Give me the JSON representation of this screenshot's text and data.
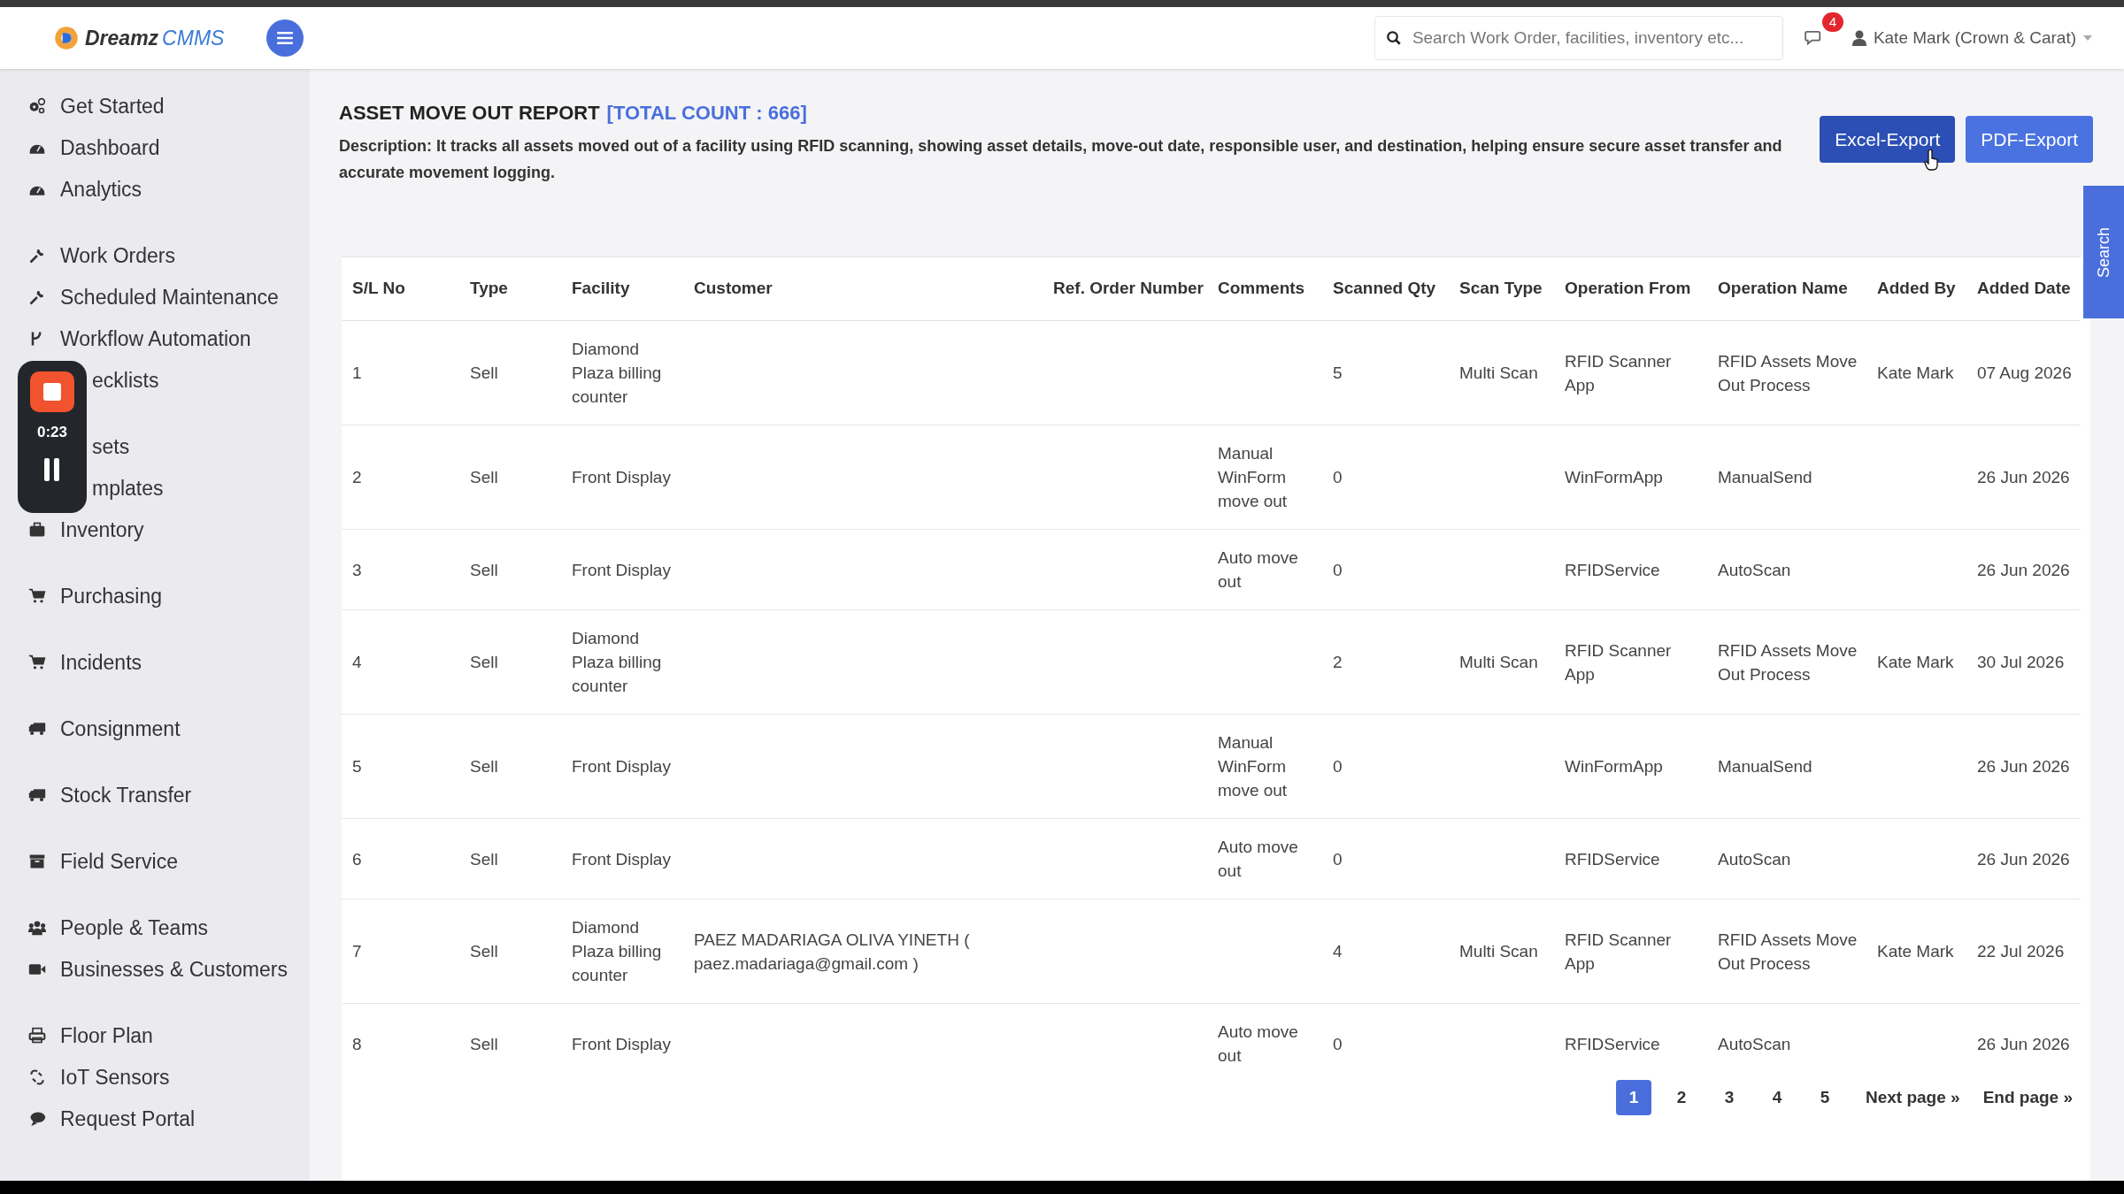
{
  "header": {
    "logo": {
      "name": "Dreamz",
      "suffix": "CMMS"
    },
    "search": {
      "placeholder": "Search Work Order, facilities, inventory etc..."
    },
    "notification_count": "4",
    "user": "Kate Mark (Crown & Carat)"
  },
  "sidebar": {
    "groups": [
      [
        {
          "label": "Get Started"
        },
        {
          "label": "Dashboard"
        },
        {
          "label": "Analytics"
        }
      ],
      [
        {
          "label": "Work Orders"
        },
        {
          "label": "Scheduled Maintenance"
        },
        {
          "label": "Workflow Automation"
        },
        {
          "label": "ecklists"
        }
      ],
      [
        {
          "label": "sets"
        },
        {
          "label": "mplates"
        },
        {
          "label": "Inventory"
        }
      ],
      [
        {
          "label": "Purchasing"
        }
      ],
      [
        {
          "label": "Incidents"
        }
      ],
      [
        {
          "label": "Consignment"
        }
      ],
      [
        {
          "label": "Stock Transfer"
        }
      ],
      [
        {
          "label": "Field Service"
        }
      ],
      [
        {
          "label": "People & Teams"
        },
        {
          "label": "Businesses & Customers"
        }
      ],
      [
        {
          "label": "Floor Plan"
        },
        {
          "label": "IoT Sensors"
        },
        {
          "label": "Request Portal"
        }
      ]
    ]
  },
  "recorder": {
    "time": "0:23"
  },
  "report": {
    "title": "ASSET MOVE OUT REPORT",
    "count": "[TOTAL COUNT : 666]",
    "description": "Description: It tracks all assets moved out of a facility using RFID scanning, showing asset details, move-out date, responsible user, and destination, helping ensure secure asset transfer and accurate movement logging.",
    "buttons": [
      {
        "label": "Excel-Export",
        "kind": "primary"
      },
      {
        "label": "PDF-Export",
        "kind": "secondary"
      }
    ]
  },
  "search_tab": "Search",
  "table": {
    "columns": [
      "S/L No",
      "Type",
      "Facility",
      "Customer",
      "Ref. Order Number",
      "Comments",
      "Scanned Qty",
      "Scan Type",
      "Operation From",
      "Operation Name",
      "Added By",
      "Added Date"
    ],
    "rows": [
      [
        "1",
        "Sell",
        "Diamond Plaza billing counter",
        null,
        null,
        null,
        "5",
        "Multi Scan",
        "RFID Scanner App",
        "RFID Assets Move Out Process",
        "Kate Mark",
        "07 Aug 2026"
      ],
      [
        "2",
        "Sell",
        "Front Display",
        null,
        null,
        "Manual WinForm move out",
        "0",
        null,
        "WinFormApp",
        "ManualSend",
        null,
        "26 Jun 2026"
      ],
      [
        "3",
        "Sell",
        "Front Display",
        null,
        null,
        "Auto move out",
        "0",
        null,
        "RFIDService",
        "AutoScan",
        null,
        "26 Jun 2026"
      ],
      [
        "4",
        "Sell",
        "Diamond Plaza billing counter",
        null,
        null,
        null,
        "2",
        "Multi Scan",
        "RFID Scanner App",
        "RFID Assets Move Out Process",
        "Kate Mark",
        "30 Jul 2026"
      ],
      [
        "5",
        "Sell",
        "Front Display",
        null,
        null,
        "Manual WinForm move out",
        "0",
        null,
        "WinFormApp",
        "ManualSend",
        null,
        "26 Jun 2026"
      ],
      [
        "6",
        "Sell",
        "Front Display",
        null,
        null,
        "Auto move out",
        "0",
        null,
        "RFIDService",
        "AutoScan",
        null,
        "26 Jun 2026"
      ],
      [
        "7",
        "Sell",
        "Diamond Plaza billing counter",
        "PAEZ MADARIAGA OLIVA YINETH ( paez.madariaga@gmail.com )",
        null,
        null,
        "4",
        "Multi Scan",
        "RFID Scanner App",
        "RFID Assets Move Out Process",
        "Kate Mark",
        "22 Jul 2026"
      ],
      [
        "8",
        "Sell",
        "Front Display",
        null,
        null,
        "Auto move out",
        "0",
        null,
        "RFIDService",
        "AutoScan",
        null,
        "26 Jun 2026"
      ]
    ]
  },
  "pagination": {
    "pages": [
      {
        "label": "1",
        "selected": true
      },
      {
        "label": "2",
        "selected": false
      },
      {
        "label": "3",
        "selected": false
      },
      {
        "label": "4",
        "selected": false
      },
      {
        "label": "5",
        "selected": false
      }
    ],
    "links": [
      "Next page »",
      "End page »"
    ]
  }
}
